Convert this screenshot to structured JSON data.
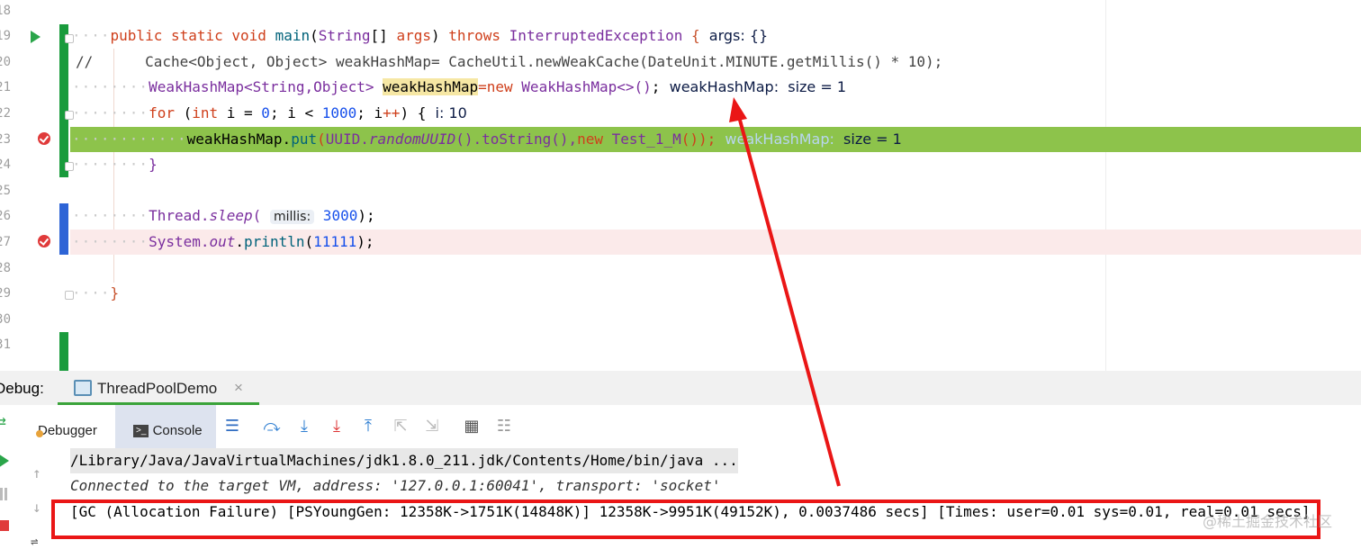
{
  "editor": {
    "line_numbers": [
      "18",
      "19",
      "20",
      "21",
      "22",
      "23",
      "24",
      "25",
      "26",
      "27",
      "28",
      "29",
      "30",
      "31"
    ],
    "code": {
      "l19": {
        "kw1": "public static void ",
        "fn": "main",
        "p1": "(",
        "type": "String",
        "p2": "[] ",
        "arg": "args",
        "p3": ") ",
        "throws": "throws ",
        "exc": "InterruptedException",
        "brace": " {",
        "hint": "  args: {}"
      },
      "l20": {
        "text": "//      Cache<Object, Object> weakHashMap= CacheUtil.newWeakCache(DateUnit.MINUTE.getMillis() * 10);"
      },
      "l21": {
        "t1": "WeakHashMap<String,Object> ",
        "var": "weakHashMap",
        "t2": "=new ",
        "t3": "WeakHashMap<>()",
        "t4": ";",
        "hint": "  weakHashMap:  size = 1"
      },
      "l22": {
        "kw": "for ",
        "p1": "(",
        "kw2": "int ",
        "i": "i = ",
        "n0": "0",
        "s1": "; i < ",
        "n1": "1000",
        "s2": "; i",
        "pp": "++",
        ") {": ") {",
        "hint": "  i: 10"
      },
      "l23": {
        "a": "weakHashMap.",
        "put": "put",
        "p1": "(",
        "uuid": "UUID.",
        "rand": "randomUUID",
        "p2": "().",
        "ts": "toString",
        "p3": "(),",
        "new": "new ",
        "cls": "Test_1_M",
        "p4": "());",
        "hint_gray": "  weakHashMap:",
        "hint": "  size = 1"
      },
      "l24": {
        "text": "}"
      },
      "l26": {
        "t1": "Thread.",
        "sleep": "sleep",
        "p1": "(",
        "param": "millis:",
        "n": " 3000",
        "p2": ");"
      },
      "l27": {
        "t1": "System.",
        "out": "out",
        "t2": ".",
        "fn": "println",
        "p1": "(",
        "n": "11111",
        "p2": ");"
      },
      "l29": {
        "text": "}"
      }
    }
  },
  "debug": {
    "label": "Debug:",
    "tab_label": "ThreadPoolDemo",
    "close": "×",
    "subtabs": {
      "debugger": "Debugger",
      "console": "Console"
    },
    "console_lines": [
      "/Library/Java/JavaVirtualMachines/jdk1.8.0_211.jdk/Contents/Home/bin/java ...",
      "Connected to the target VM, address: '127.0.0.1:60041', transport: 'socket'",
      "[GC (Allocation Failure) [PSYoungGen: 12358K->1751K(14848K)] 12358K->9951K(49152K), 0.0037486 secs] [Times: user=0.01 sys=0.01, real=0.01 secs]"
    ]
  },
  "watermark": "@稀土掘金技术社区",
  "icons": [
    "run-arrow-icon",
    "breakpoint-icon",
    "fold-marker-icon",
    "console-tab-icon",
    "rerun-icon",
    "resume-icon",
    "pause-icon",
    "stop-icon",
    "step-up-icon",
    "step-down-icon",
    "menu-icon",
    "step-over-icon",
    "step-into-icon",
    "force-step-into-icon",
    "step-out-icon",
    "drop-frame-icon",
    "run-to-cursor-icon",
    "evaluate-icon",
    "trace-icon",
    "layout-icon"
  ],
  "colors": {
    "execution_line": "#8dc34b",
    "breakpoint_line": "#fbeaea",
    "annotation": "#ea1616",
    "tab_active": "#3aa33a"
  }
}
